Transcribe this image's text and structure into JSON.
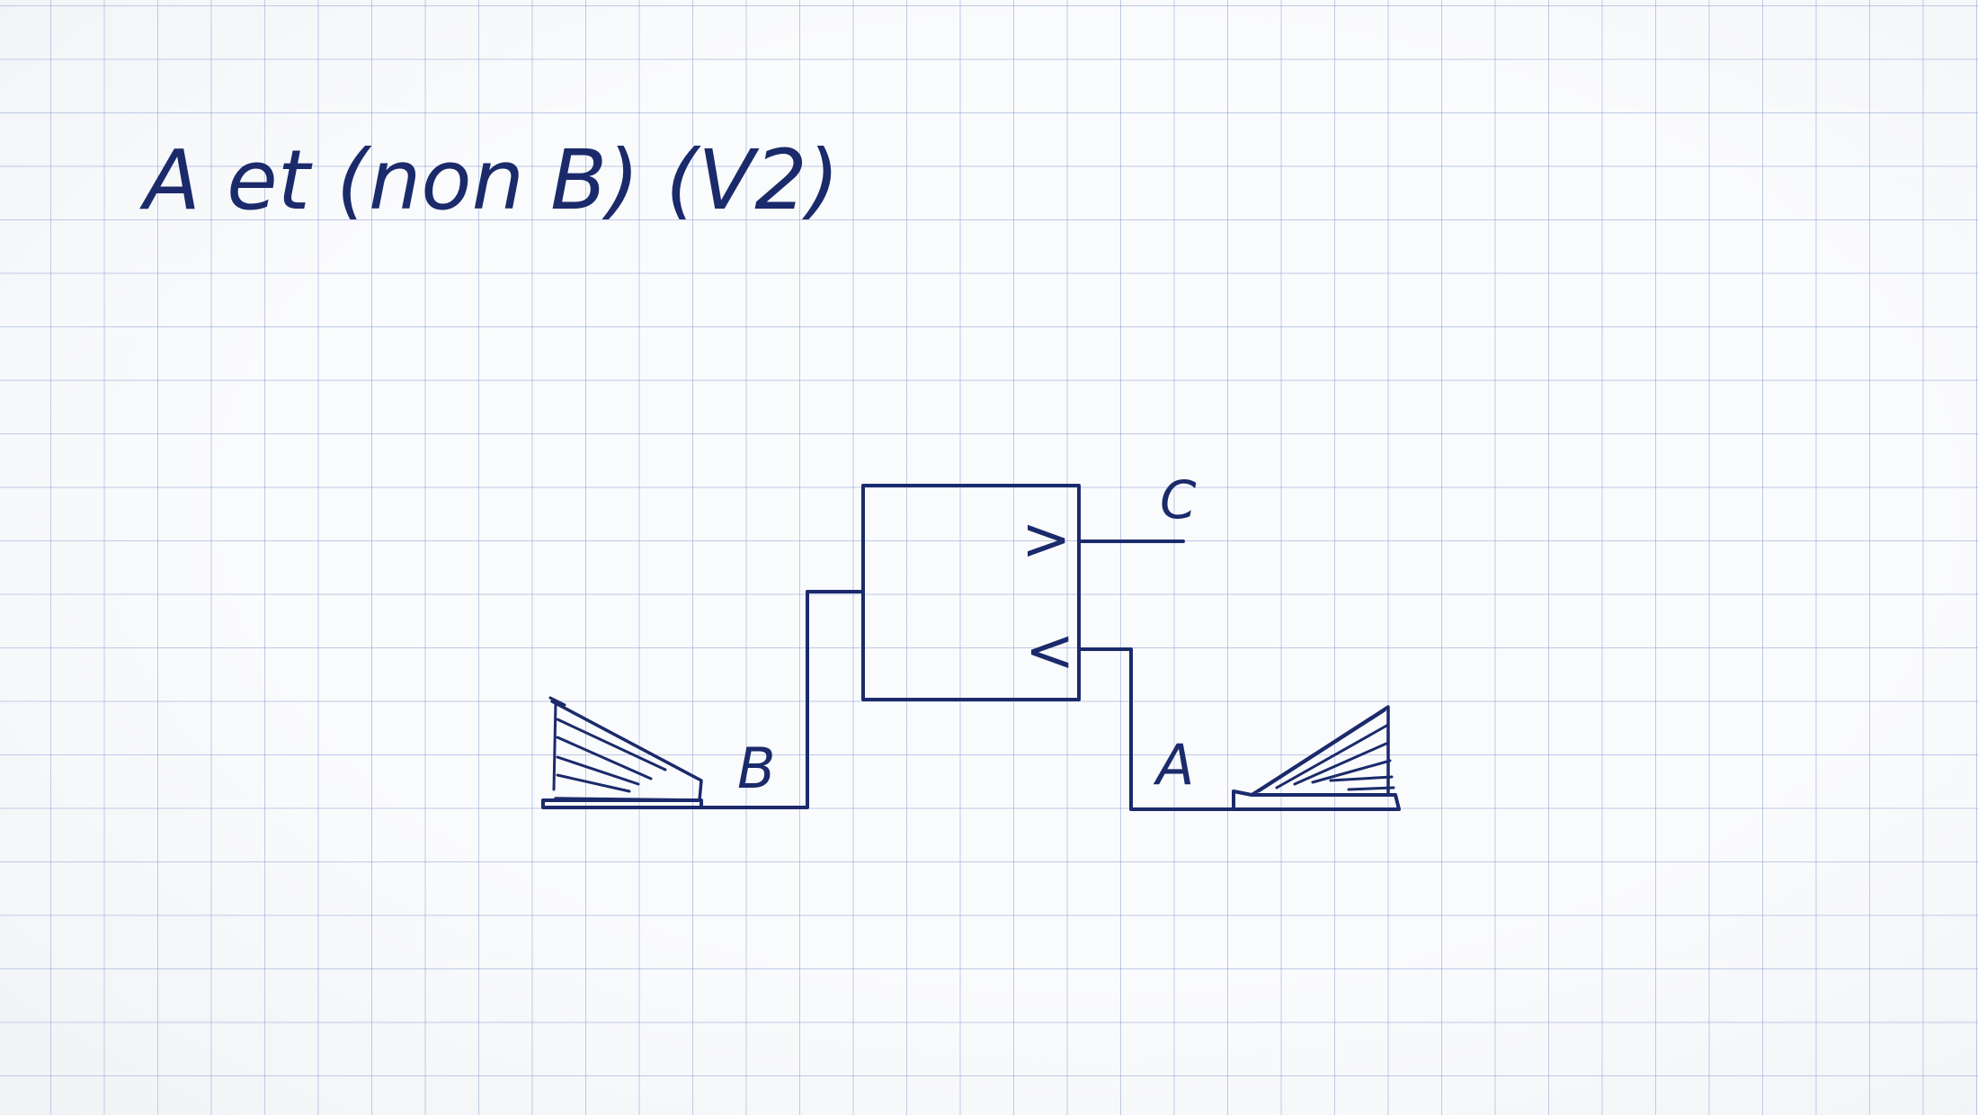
{
  "title": "A et (non B) (V2)",
  "labels": {
    "output": "C",
    "input_left": "B",
    "input_right": "A",
    "upper_comparator": ">",
    "lower_comparator": "<"
  },
  "colors": {
    "ink": "#1b2a6b",
    "grid": "#8c9fdc",
    "paper": "#fafbfc"
  }
}
